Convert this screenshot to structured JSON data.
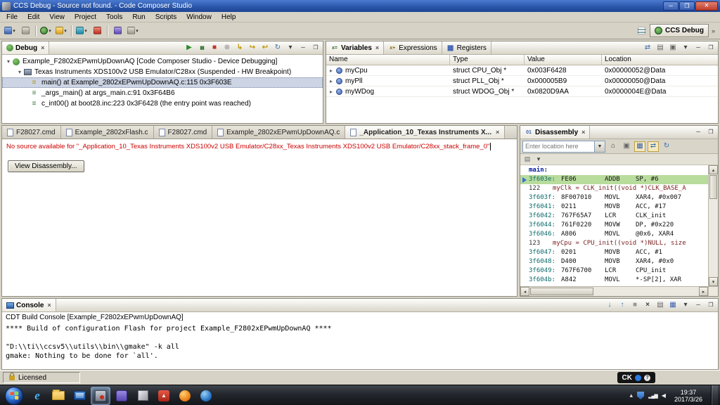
{
  "window": {
    "title": "CCS Debug - Source not found. - Code Composer Studio"
  },
  "menu": {
    "items": [
      "File",
      "Edit",
      "View",
      "Project",
      "Tools",
      "Run",
      "Scripts",
      "Window",
      "Help"
    ]
  },
  "toolbar": {
    "perspective_label": "CCS Debug"
  },
  "debug_view": {
    "tab_label": "Debug",
    "rows": [
      {
        "label": "Example_F2802xEPwmUpDownAQ [Code Composer Studio - Device Debugging]"
      },
      {
        "label": "Texas Instruments XDS100v2 USB Emulator/C28xx (Suspended - HW Breakpoint)"
      },
      {
        "label": "main() at Example_2802xEPwmUpDownAQ.c:115 0x3F603E"
      },
      {
        "label": "_args_main() at args_main.c:91 0x3F64B6"
      },
      {
        "label": "c_int00() at boot28.inc:223 0x3F6428  (the entry point was reached)"
      }
    ]
  },
  "variables_view": {
    "tabs": [
      "Variables",
      "Expressions",
      "Registers"
    ],
    "columns": [
      "Name",
      "Type",
      "Value",
      "Location"
    ],
    "rows": [
      {
        "name": "myCpu",
        "type": "struct CPU_Obj *",
        "value": "0x003F6428",
        "location": "0x00000052@Data"
      },
      {
        "name": "myPll",
        "type": "struct PLL_Obj *",
        "value": "0x000005B9",
        "location": "0x00000050@Data"
      },
      {
        "name": "myWDog",
        "type": "struct WDOG_Obj *",
        "value": "0x0820D9AA",
        "location": "0x0000004E@Data"
      }
    ]
  },
  "editor": {
    "tabs": [
      "F28027.cmd",
      "Example_2802xFlash.c",
      "F28027.cmd",
      "Example_2802xEPwmUpDownAQ.c",
      "_Application_10_Texas Instruments X..."
    ],
    "message": "No source available for \"_Application_10_Texas Instruments XDS100v2 USB Emulator/C28xx_Texas Instruments XDS100v2 USB Emulator/C28xx_stack_frame_0\"",
    "view_disassembly": "View Disassembly..."
  },
  "disassembly": {
    "tab_label": "Disassembly",
    "location_placeholder": "Enter location here",
    "lines": [
      {
        "t": "label",
        "text": "main:"
      },
      {
        "t": "asm",
        "addr": "3f603e:",
        "op": "FE06",
        "mn": "ADDB",
        "args": "SP, #6"
      },
      {
        "t": "src",
        "num": "122",
        "text": "myClk = CLK_init((void *)CLK_BASE_A"
      },
      {
        "t": "asm",
        "addr": "3f603f:",
        "op": "8F007010",
        "mn": "MOVL",
        "args": "XAR4, #0x007"
      },
      {
        "t": "asm",
        "addr": "3f6041:",
        "op": "0211",
        "mn": "MOVB",
        "args": "ACC, #17"
      },
      {
        "t": "asm",
        "addr": "3f6042:",
        "op": "767F65A7",
        "mn": "LCR",
        "args": "CLK_init"
      },
      {
        "t": "asm",
        "addr": "3f6044:",
        "op": "761F0220",
        "mn": "MOVW",
        "args": "DP, #0x220"
      },
      {
        "t": "asm",
        "addr": "3f6046:",
        "op": "A806",
        "mn": "MOVL",
        "args": "@0x6, XAR4"
      },
      {
        "t": "src",
        "num": "123",
        "text": "myCpu = CPU_init((void *)NULL, size"
      },
      {
        "t": "asm",
        "addr": "3f6047:",
        "op": "0201",
        "mn": "MOVB",
        "args": "ACC, #1"
      },
      {
        "t": "asm",
        "addr": "3f6048:",
        "op": "D400",
        "mn": "MOVB",
        "args": "XAR4, #0x0"
      },
      {
        "t": "asm",
        "addr": "3f6049:",
        "op": "767F6700",
        "mn": "LCR",
        "args": "CPU_init"
      },
      {
        "t": "asm",
        "addr": "3f604b:",
        "op": "A842",
        "mn": "MOVL",
        "args": "*-SP[2], XAR"
      }
    ]
  },
  "console": {
    "tab_label": "Console",
    "subtitle": "CDT Build Console [Example_F2802xEPwmUpDownAQ]",
    "lines": [
      "**** Build of configuration Flash for project Example_F2802xEPwmUpDownAQ ****",
      "",
      "\"D:\\\\ti\\\\ccsv5\\\\utils\\\\bin\\\\gmake\" -k all",
      "gmake: Nothing to be done for `all'."
    ]
  },
  "status": {
    "license": "Licensed",
    "ime": "CK"
  },
  "taskbar": {
    "time": "19:37",
    "date": "2017/3/26"
  }
}
